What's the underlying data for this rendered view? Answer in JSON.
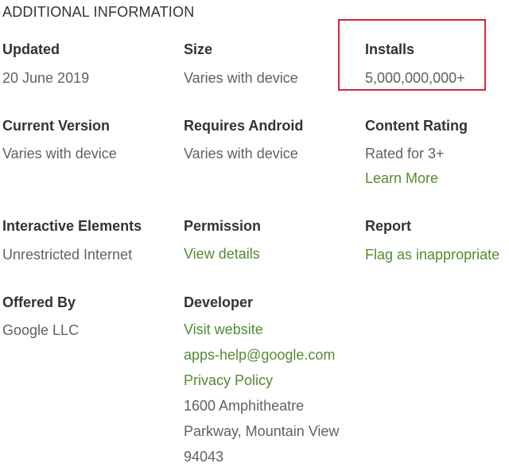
{
  "section": {
    "title": "ADDITIONAL INFORMATION"
  },
  "colors": {
    "label": "#333333",
    "value": "#616161",
    "link": "#558b2f",
    "highlight": "#d7263d"
  },
  "rows": {
    "updated": {
      "label": "Updated",
      "value": "20 June 2019"
    },
    "size": {
      "label": "Size",
      "value": "Varies with device"
    },
    "installs": {
      "label": "Installs",
      "value": "5,000,000,000+"
    },
    "current_version": {
      "label": "Current Version",
      "value": "Varies with device"
    },
    "requires_android": {
      "label": "Requires Android",
      "value": "Varies with device"
    },
    "content_rating": {
      "label": "Content Rating",
      "value": "Rated for 3+",
      "link": "Learn More"
    },
    "interactive_elements": {
      "label": "Interactive Elements",
      "value": "Unrestricted Internet"
    },
    "permission": {
      "label": "Permission",
      "link": "View details"
    },
    "report": {
      "label": "Report",
      "link": "Flag as inappropriate"
    },
    "offered_by": {
      "label": "Offered By",
      "value": "Google LLC"
    },
    "developer": {
      "label": "Developer",
      "website": "Visit website",
      "email": "apps-help@google.com",
      "privacy": "Privacy Policy",
      "address_line1": "1600 Amphitheatre",
      "address_line2": "Parkway, Mountain View",
      "address_line3": "94043"
    }
  }
}
